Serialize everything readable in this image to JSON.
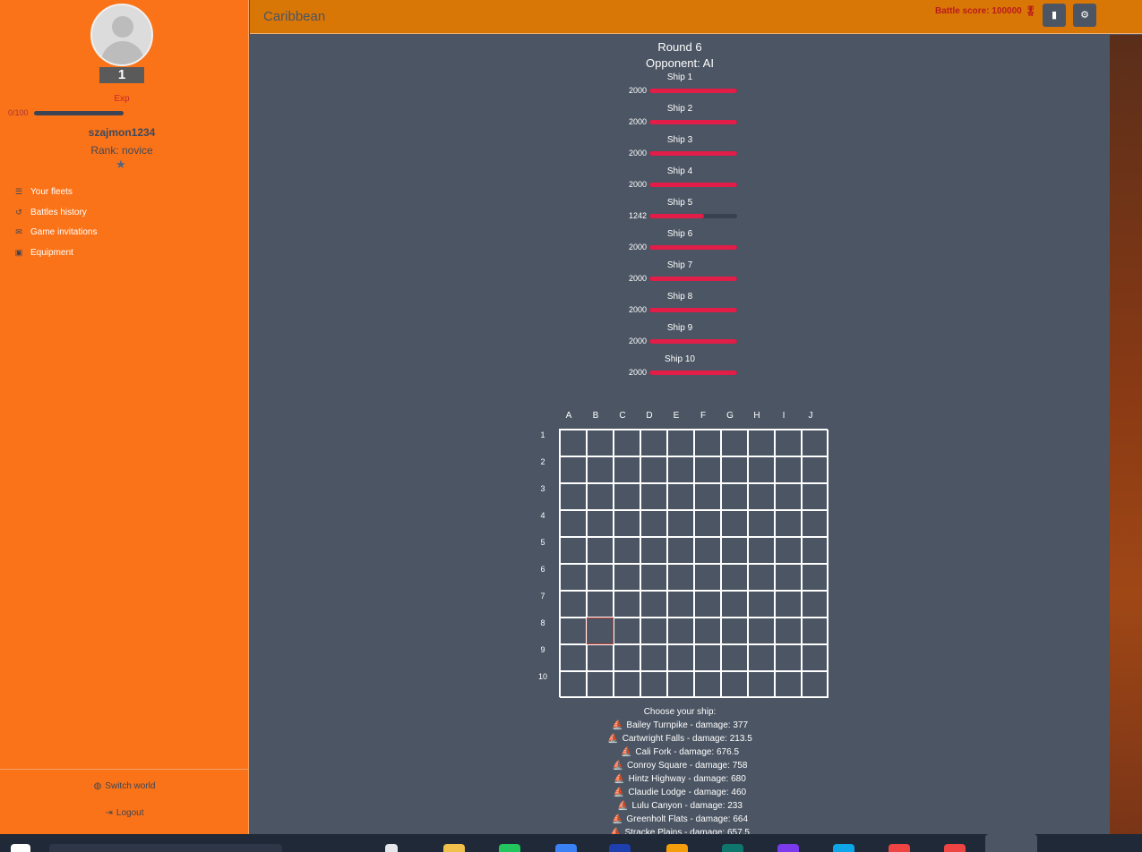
{
  "sidebar": {
    "level": "1",
    "exp_label": "Exp",
    "exp_value": "0/100",
    "username": "szajmon1234",
    "rank": "Rank: novice",
    "nav": [
      {
        "label": "Your fleets",
        "icon": "list-icon"
      },
      {
        "label": "Battles history",
        "icon": "history-icon"
      },
      {
        "label": "Game invitations",
        "icon": "envelope-icon"
      },
      {
        "label": "Equipment",
        "icon": "briefcase-icon"
      }
    ],
    "footer": {
      "switch_world": "Switch world",
      "logout": "Logout"
    }
  },
  "header": {
    "world_name": "Caribbean",
    "battle_score": "Battle score: 100000"
  },
  "battle": {
    "round": "Round 6",
    "opponent": "Opponent: AI",
    "max_hp": 2000,
    "ships": [
      {
        "name": "Ship 1",
        "hp": "2000"
      },
      {
        "name": "Ship 2",
        "hp": "2000"
      },
      {
        "name": "Ship 3",
        "hp": "2000"
      },
      {
        "name": "Ship 4",
        "hp": "2000"
      },
      {
        "name": "Ship 5",
        "hp": "1242"
      },
      {
        "name": "Ship 6",
        "hp": "2000"
      },
      {
        "name": "Ship 7",
        "hp": "2000"
      },
      {
        "name": "Ship 8",
        "hp": "2000"
      },
      {
        "name": "Ship 9",
        "hp": "2000"
      },
      {
        "name": "Ship 10",
        "hp": "2000"
      }
    ]
  },
  "board": {
    "columns": [
      "A",
      "B",
      "C",
      "D",
      "E",
      "F",
      "G",
      "H",
      "I",
      "J"
    ],
    "rows": [
      "1",
      "2",
      "3",
      "4",
      "5",
      "6",
      "7",
      "8",
      "9",
      "10"
    ],
    "selected_cell": "B8"
  },
  "fleet": {
    "title": "Choose your ship:",
    "ships": [
      "Bailey Turnpike - damage: 377",
      "Cartwright Falls - damage: 213.5",
      "Cali Fork - damage: 676.5",
      "Conroy Square - damage: 758",
      "Hintz Highway - damage: 680",
      "Claudie Lodge - damage: 460",
      "Lulu Canyon - damage: 233",
      "Greenholt Flats - damage: 664",
      "Stracke Plains - damage: 657.5"
    ]
  },
  "colors": {
    "sidebar": "#fb7318",
    "header": "#d97706",
    "main": "#4b5563",
    "hp_bar": "#e11d48",
    "accent_red": "#b91c1c"
  }
}
